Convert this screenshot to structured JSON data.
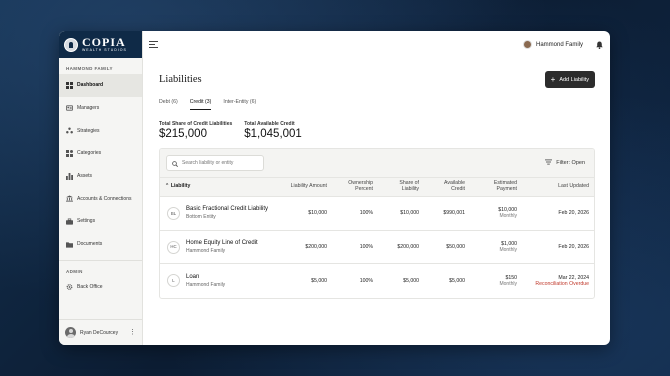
{
  "app": {
    "logo_main": "COPIA",
    "logo_sub": "WEALTH STUDIOS"
  },
  "colors": {
    "brand_navy": "#0f2a47",
    "overdue_red": "#c0392b",
    "button_dark": "#2c2c2c"
  },
  "sidebar": {
    "section_label": "HAMMOND FAMILY",
    "items": [
      {
        "label": "Dashboard",
        "icon": "dashboard-icon",
        "active": true
      },
      {
        "label": "Managers",
        "icon": "id-card-icon"
      },
      {
        "label": "Strategies",
        "icon": "nodes-icon"
      },
      {
        "label": "Categories",
        "icon": "grid-icon"
      },
      {
        "label": "Assets",
        "icon": "bar-chart-icon"
      },
      {
        "label": "Accounts & Connections",
        "icon": "bank-icon"
      },
      {
        "label": "Settings",
        "icon": "toolbox-icon"
      },
      {
        "label": "Documents",
        "icon": "folder-icon"
      }
    ],
    "admin_label": "ADMIN",
    "admin_items": [
      {
        "label": "Back Office",
        "icon": "gear-icon"
      }
    ],
    "user_name": "Ryan DeCourcey"
  },
  "header": {
    "family_name": "Hammond Family"
  },
  "page": {
    "title": "Liabilities",
    "add_button": "Add Liability",
    "tabs": [
      {
        "label": "Debt (6)"
      },
      {
        "label": "Credit (3)",
        "active": true
      },
      {
        "label": "Inter-Entity (6)"
      }
    ],
    "summary": [
      {
        "label": "Total Share of Credit Liabilities",
        "value": "$215,000"
      },
      {
        "label": "Total Available Credit",
        "value": "$1,045,001"
      }
    ]
  },
  "table": {
    "search_placeholder": "Search liability or entity",
    "filter_label": "Filter: Open",
    "columns": {
      "liability": "Liability",
      "liability_amount": "Liability Amount",
      "ownership_percent": "Ownership Percent",
      "share_of_liability": "Share of Liability",
      "available_credit": "Available Credit",
      "estimated_payment": "Estimated Payment",
      "last_updated": "Last Updated"
    },
    "rows": [
      {
        "initials": "BL",
        "name": "Basic Fractional Credit Liability",
        "owner": "Bottom Entity",
        "liability_amount": "$10,000",
        "ownership_percent": "100%",
        "share": "$10,000",
        "available_credit": "$990,001",
        "payment": "$10,000",
        "payment_freq": "Monthly",
        "last_updated": "Feb 20, 2026",
        "status": ""
      },
      {
        "initials": "HC",
        "name": "Home Equity Line of Credit",
        "owner": "Hammond Family",
        "liability_amount": "$200,000",
        "ownership_percent": "100%",
        "share": "$200,000",
        "available_credit": "$50,000",
        "payment": "$1,000",
        "payment_freq": "Monthly",
        "last_updated": "Feb 20, 2026",
        "status": ""
      },
      {
        "initials": "L",
        "name": "Loan",
        "owner": "Hammond Family",
        "liability_amount": "$5,000",
        "ownership_percent": "100%",
        "share": "$5,000",
        "available_credit": "$5,000",
        "payment": "$150",
        "payment_freq": "Monthly",
        "last_updated": "Mar 22, 2024",
        "status": "Reconciliation Overdue"
      }
    ]
  }
}
